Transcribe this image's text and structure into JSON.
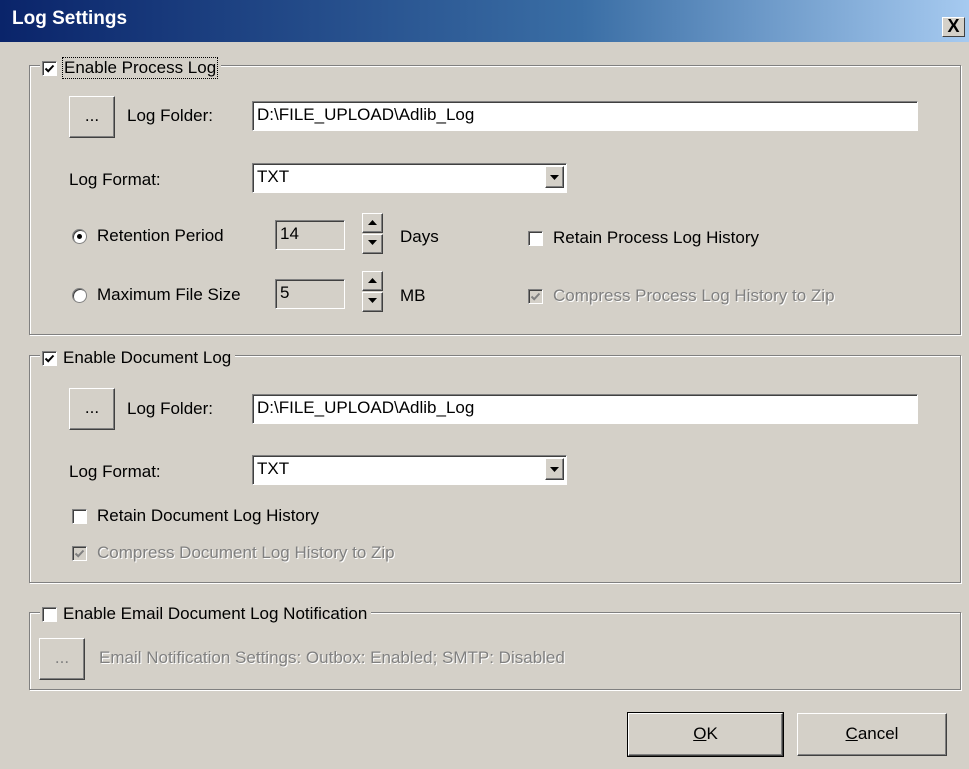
{
  "window": {
    "title": "Log Settings",
    "close_label": "X"
  },
  "process_log": {
    "enable_label": "Enable Process Log",
    "browse_label": "...",
    "folder_label": "Log Folder:",
    "folder_value": "D:\\FILE_UPLOAD\\Adlib_Log",
    "format_label": "Log Format:",
    "format_value": "TXT",
    "retention_label": "Retention Period",
    "retention_value": "14",
    "retention_unit": "Days",
    "max_size_label": "Maximum File Size",
    "max_size_value": "5",
    "max_size_unit": "MB",
    "retain_history_label": "Retain Process Log History",
    "compress_label": "Compress Process Log History to Zip"
  },
  "document_log": {
    "enable_label": "Enable Document Log",
    "browse_label": "...",
    "folder_label": "Log Folder:",
    "folder_value": "D:\\FILE_UPLOAD\\Adlib_Log",
    "format_label": "Log Format:",
    "format_value": "TXT",
    "retain_history_label": "Retain Document Log History",
    "compress_label": "Compress Document Log History to Zip"
  },
  "email": {
    "enable_label": "Enable Email Document Log Notification",
    "browse_label": "...",
    "settings_text": "Email Notification Settings: Outbox: Enabled; SMTP: Disabled"
  },
  "footer": {
    "ok_mnemonic": "O",
    "ok_rest": "K",
    "cancel_mnemonic": "C",
    "cancel_rest": "ancel"
  }
}
